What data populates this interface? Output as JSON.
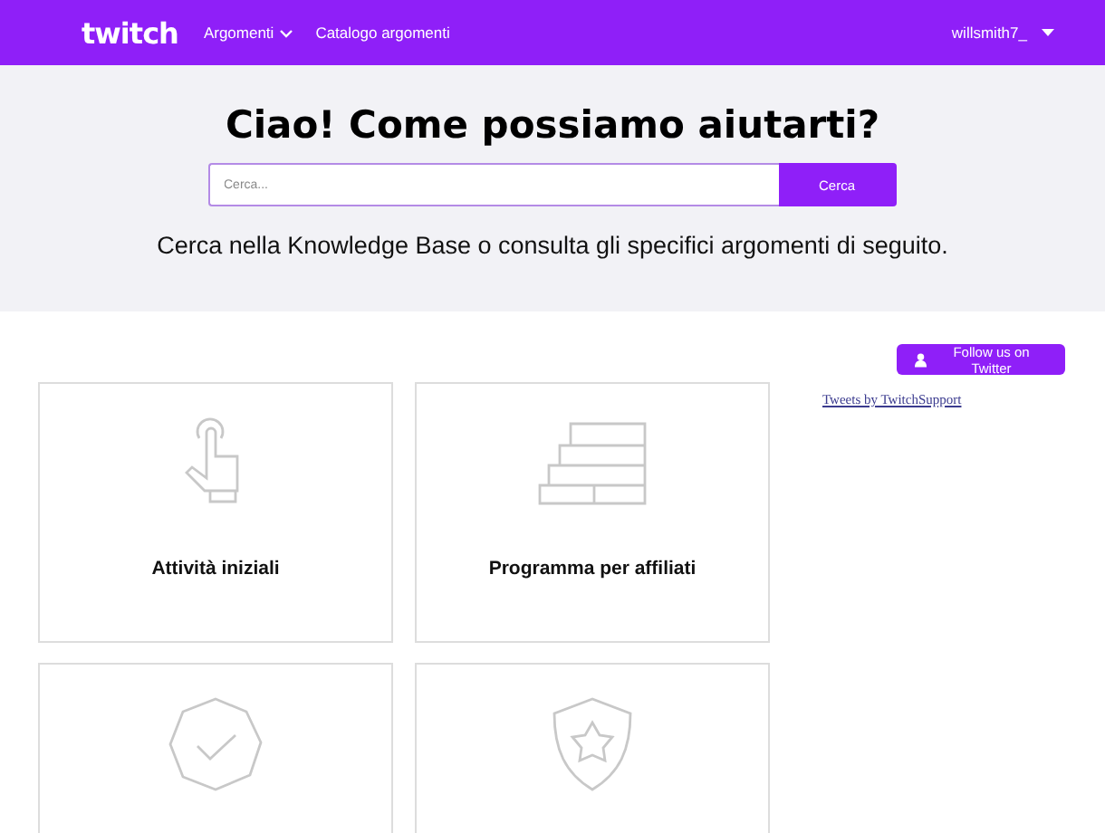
{
  "header": {
    "logo": "twitch",
    "nav": [
      {
        "label": "Argomenti",
        "dropdown": true
      },
      {
        "label": "Catalogo argomenti",
        "dropdown": false
      }
    ],
    "user": "willsmith7_"
  },
  "hero": {
    "title": "Ciao! Come possiamo aiutarti?",
    "search": {
      "placeholder": "Cerca...",
      "button": "Cerca"
    },
    "subtitle": "Cerca nella Knowledge Base o consulta gli specifici argomenti di seguito."
  },
  "cards": [
    {
      "kind": "topic",
      "label": "Attività iniziali"
    },
    {
      "kind": "topic",
      "label": "Programma per affiliati"
    },
    {
      "kind": "topic"
    },
    {
      "kind": "topic"
    }
  ],
  "sidebar": {
    "follow_button": "Follow us on Twitter",
    "tweets_link": "Tweets by TwitchSupport"
  }
}
